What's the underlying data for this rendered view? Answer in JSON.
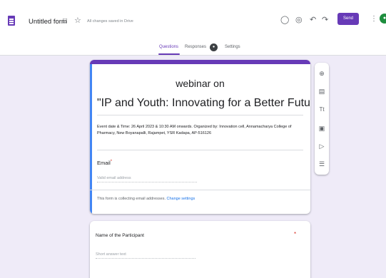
{
  "header": {
    "title": "Untitled form",
    "saved_status": "All changes saved in Drive",
    "send_label": "Send",
    "avatar_initial": "●",
    "icons": {
      "form": "forms-logo-icon",
      "folder": "folder-icon",
      "star": "star-icon",
      "palette": "palette-icon",
      "preview": "eye-icon",
      "undo": "undo-icon",
      "redo": "redo-icon",
      "more": "more-vert-icon"
    }
  },
  "tabs": {
    "questions": "Questions",
    "responses": "Responses",
    "responses_count": "●",
    "settings": "Settings"
  },
  "form": {
    "heading_line1": "webinar on",
    "heading_line2": "\"IP and Youth: Innovating for a Better Future\"",
    "description": "Event date & Time: 26 April 2023 & 10:30 AM onwards. Organized by: Innovation cell, Annamacharya College of Pharmacy, New Boyanapalli, Rajampet, YSR Kadapa, AP-516126",
    "email_label": "Email",
    "email_required": "*",
    "email_placeholder": "Valid email address",
    "collect_text": "This form is collecting email addresses.",
    "change_settings": "Change settings"
  },
  "question": {
    "label": "Name of the Participant",
    "required": "*",
    "placeholder": "Short answer text"
  },
  "toolbar": {
    "icons": [
      "add-question-icon",
      "import-questions-icon",
      "add-title-icon",
      "add-image-icon",
      "add-video-icon",
      "add-section-icon"
    ]
  },
  "colors": {
    "accent": "#673ab7",
    "background": "#efebf8",
    "link": "#1a73e8",
    "required": "#d93025"
  }
}
